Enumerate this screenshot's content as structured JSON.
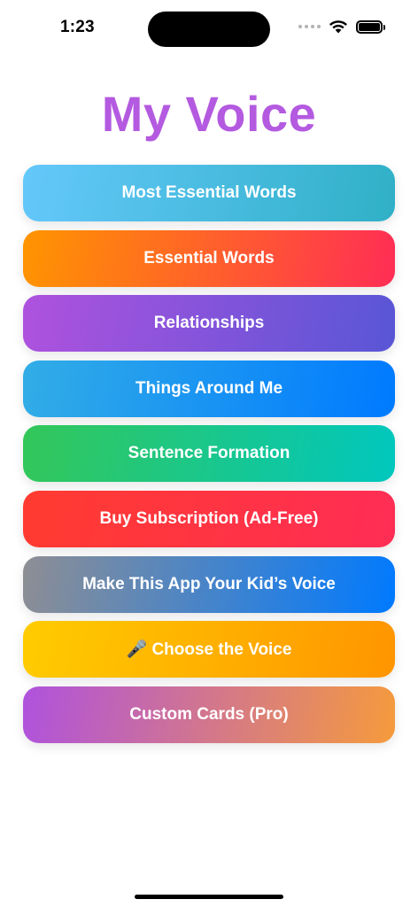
{
  "status_bar": {
    "time": "1:23",
    "wifi_icon": "wifi-icon",
    "battery_icon": "battery-icon"
  },
  "title": "My Voice",
  "title_color": "#b45ae0",
  "menu": [
    {
      "label": "Most Essential Words",
      "colors": [
        "#64c8fa",
        "#30b0c7"
      ]
    },
    {
      "label": "Essential Words",
      "colors": [
        "#ff9500",
        "#ff2d55"
      ]
    },
    {
      "label": "Relationships",
      "colors": [
        "#af52de",
        "#5856d6"
      ]
    },
    {
      "label": "Things Around Me",
      "colors": [
        "#32ade6",
        "#007aff"
      ]
    },
    {
      "label": "Sentence Formation",
      "colors": [
        "#34c759",
        "#00c7be"
      ]
    },
    {
      "label": "Buy Subscription (Ad-Free)",
      "colors": [
        "#ff3b30",
        "#ff2d55"
      ]
    },
    {
      "label": "Make This App Your Kid’s Voice",
      "colors": [
        "#8e8e93",
        "#007aff"
      ]
    },
    {
      "label": "🎤 Choose the Voice",
      "colors": [
        "#ffcc00",
        "#ff9500"
      ]
    },
    {
      "label": "Custom Cards (Pro)",
      "colors": [
        "#af52de",
        "#f59b3c"
      ]
    }
  ]
}
